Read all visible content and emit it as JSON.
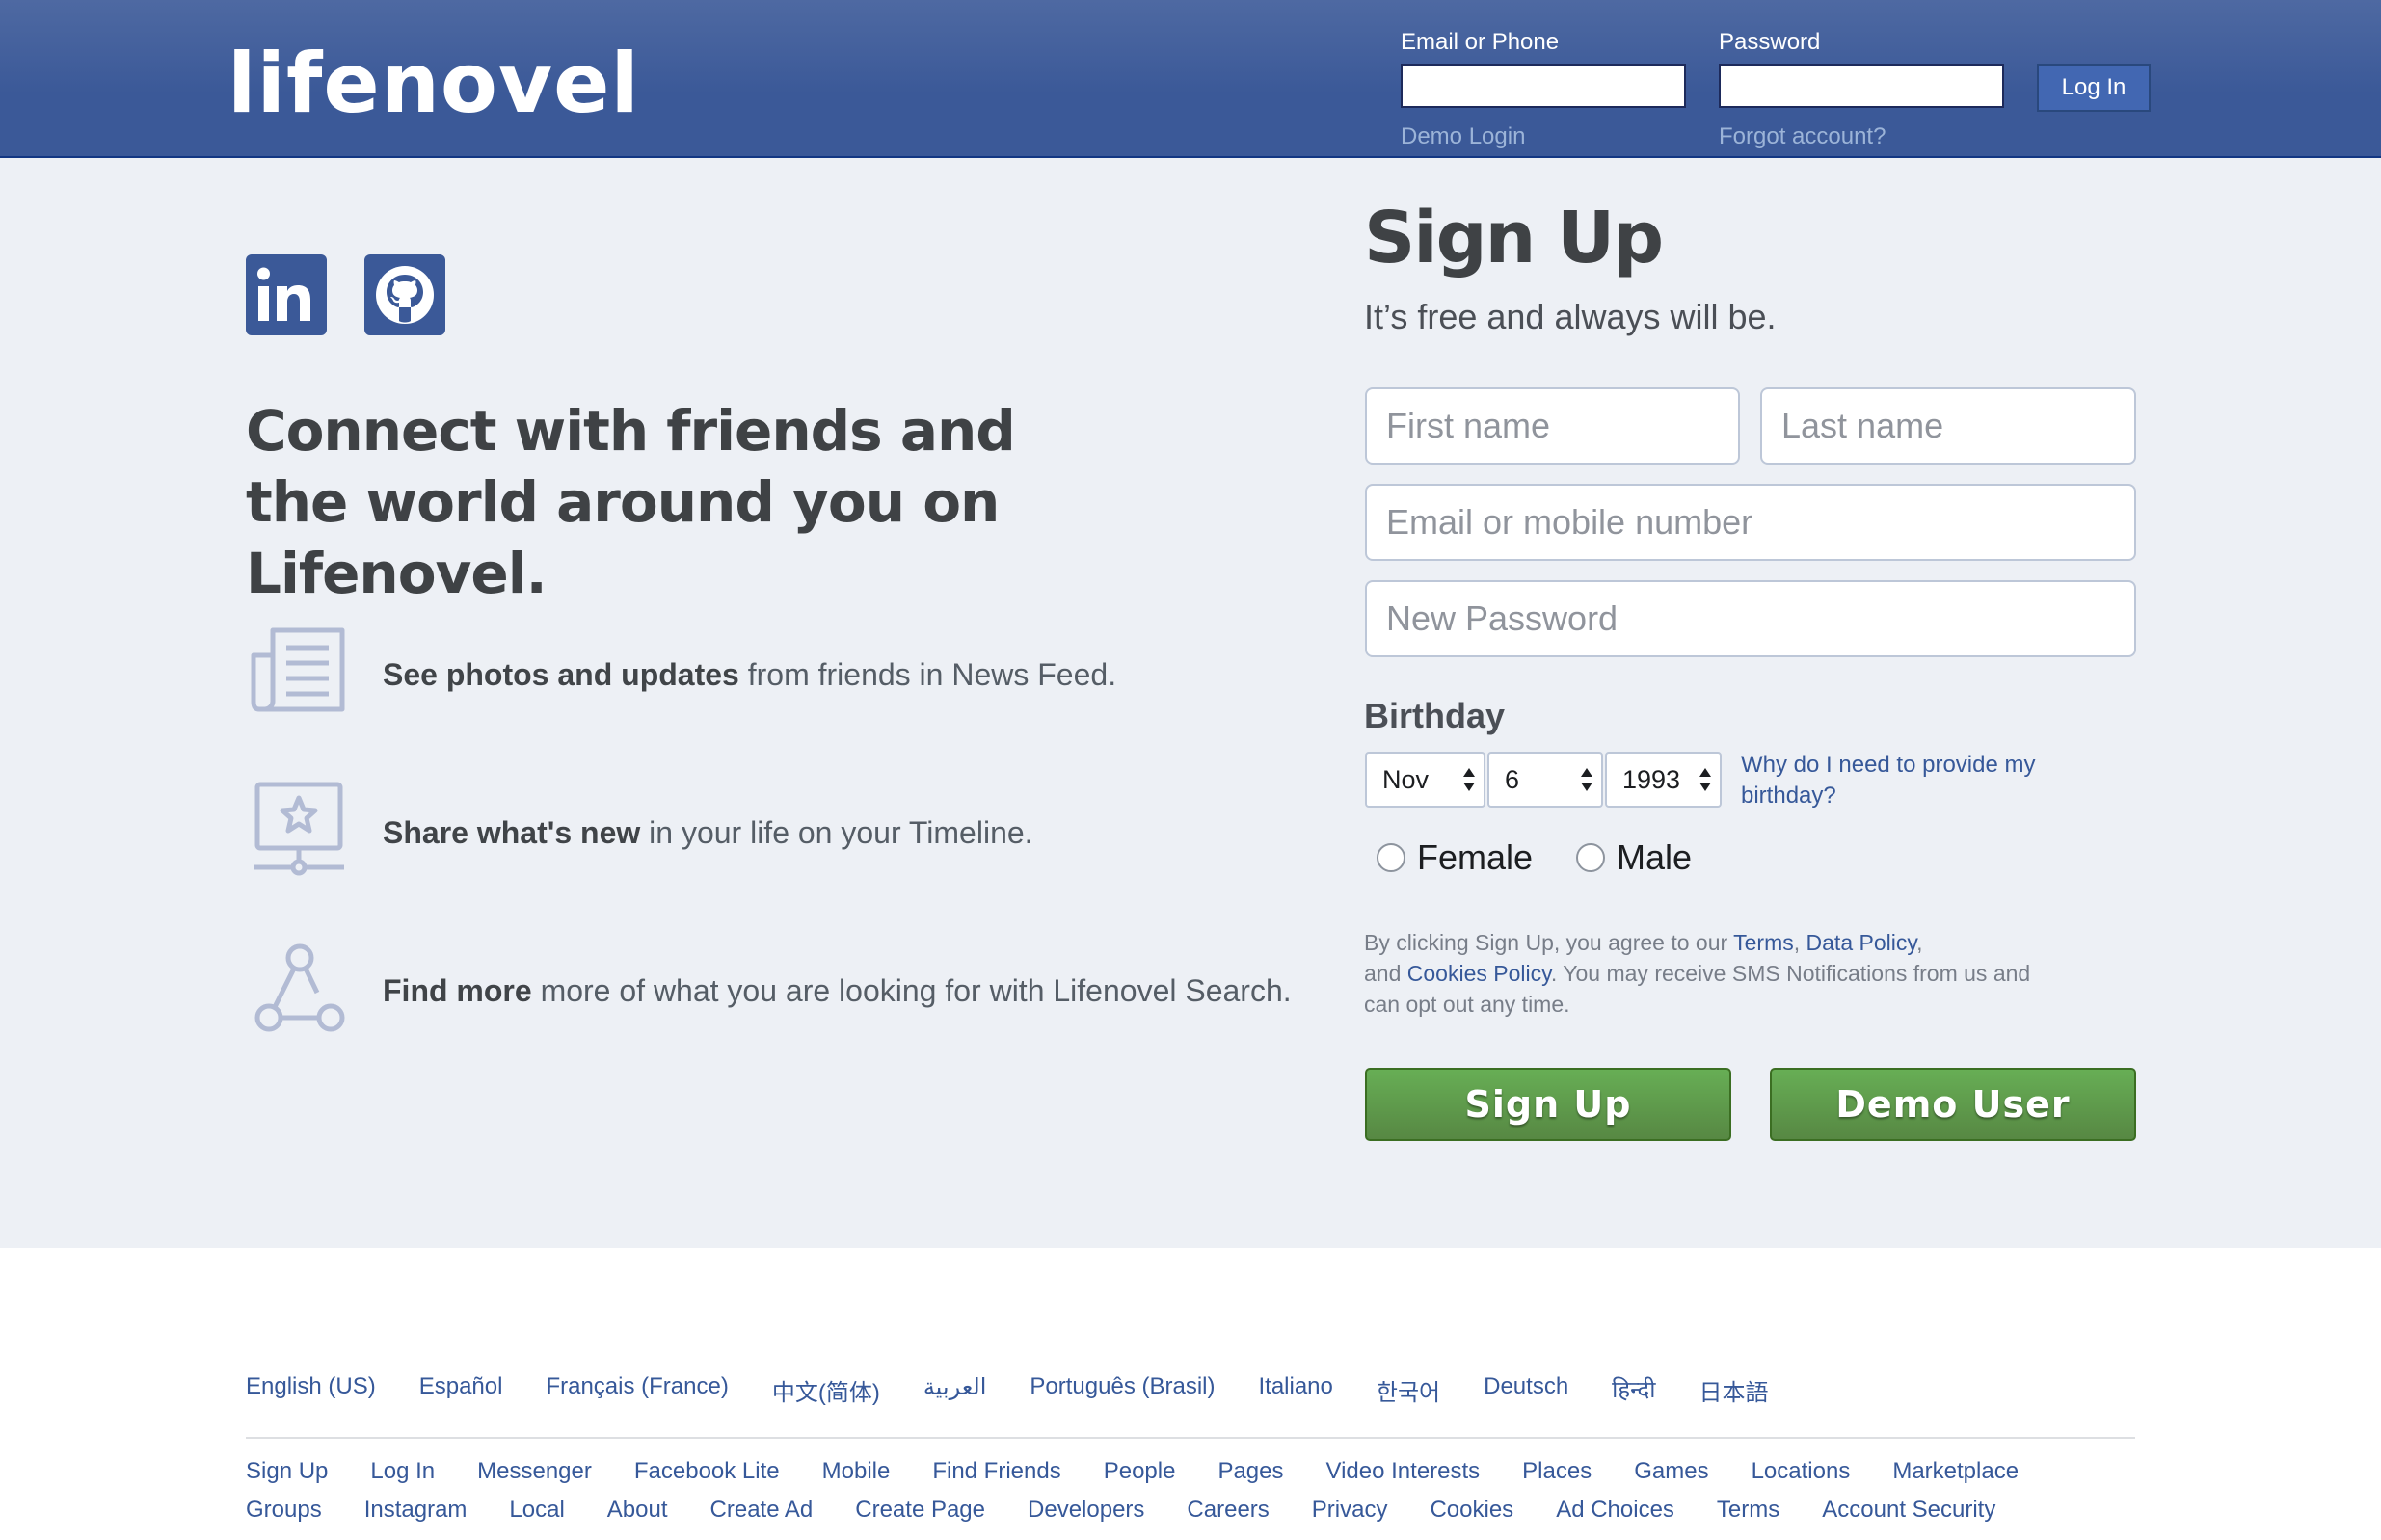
{
  "header": {
    "logo": "lifenovel",
    "email_label": "Email or Phone",
    "password_label": "Password",
    "login_button": "Log In",
    "demo_login": "Demo Login",
    "forgot_account": "Forgot account?"
  },
  "hero": {
    "headline": "Connect with friends and the world around you on Lifenovel.",
    "features": [
      {
        "bold": "See photos and updates",
        "rest": " from friends in News Feed.",
        "icon": "news-feed-icon"
      },
      {
        "bold": "Share what's new",
        "rest": " in your life on your Timeline.",
        "icon": "timeline-star-icon"
      },
      {
        "bold": "Find more",
        "rest": " more of what you are looking for with Lifenovel Search.",
        "icon": "network-search-icon"
      }
    ],
    "social_icons": [
      "linkedin-icon",
      "github-icon"
    ]
  },
  "signup": {
    "title": "Sign Up",
    "subtitle": "It’s free and always will be.",
    "first_name_placeholder": "First name",
    "last_name_placeholder": "Last name",
    "email_placeholder": "Email or mobile number",
    "password_placeholder": "New Password",
    "birthday_label": "Birthday",
    "birthday_month": "Nov",
    "birthday_day": "6",
    "birthday_year": "1993",
    "why_birthday": "Why do I need to provide my birthday?",
    "gender_female": "Female",
    "gender_male": "Male",
    "terms_prefix": "By clicking Sign Up, you agree to our ",
    "terms_link": "Terms",
    "terms_sep": ", ",
    "data_policy_link": "Data Policy",
    "terms_mid": ",",
    "terms_and": "and ",
    "cookies_link": "Cookies Policy",
    "terms_suffix": ". You may receive SMS Notifications from us and can opt out any time.",
    "signup_button": "Sign Up",
    "demo_button": "Demo User"
  },
  "colors": {
    "brand_blue": "#3b5998",
    "page_bg": "#edf0f5",
    "green_button": "#67ae55",
    "link_blue": "#365899"
  },
  "footer": {
    "languages": [
      "English (US)",
      "Español",
      "Français (France)",
      "中文(简体)",
      "العربية",
      "Português (Brasil)",
      "Italiano",
      "한국어",
      "Deutsch",
      "हिन्दी",
      "日本語"
    ],
    "links_row1": [
      "Sign Up",
      "Log In",
      "Messenger",
      "Facebook Lite",
      "Mobile",
      "Find Friends",
      "People",
      "Pages",
      "Video Interests",
      "Places",
      "Games",
      "Locations",
      "Marketplace"
    ],
    "links_row2": [
      "Groups",
      "Instagram",
      "Local",
      "About",
      "Create Ad",
      "Create Page",
      "Developers",
      "Careers",
      "Privacy",
      "Cookies",
      "Ad Choices",
      "Terms",
      "Account Security"
    ]
  }
}
